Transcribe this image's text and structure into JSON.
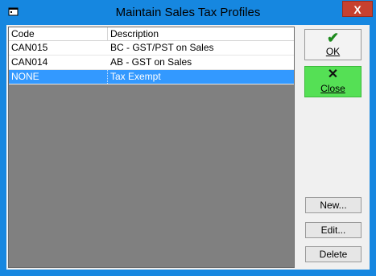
{
  "window": {
    "title": "Maintain Sales Tax Profiles",
    "close_glyph": "X"
  },
  "list": {
    "columns": {
      "code": "Code",
      "description": "Description"
    },
    "rows": [
      {
        "code": "CAN015",
        "description": "BC - GST/PST on Sales",
        "selected": false
      },
      {
        "code": "CAN014",
        "description": "AB - GST on Sales",
        "selected": false
      },
      {
        "code": "NONE",
        "description": "Tax Exempt",
        "selected": true
      }
    ]
  },
  "buttons": {
    "ok": {
      "label": "OK",
      "icon": "checkmark-icon",
      "glyph": "✔"
    },
    "close": {
      "label": "Close",
      "icon": "x-icon",
      "glyph": "✕"
    },
    "new": {
      "label": "New..."
    },
    "edit": {
      "label": "Edit..."
    },
    "delete": {
      "label": "Delete"
    }
  },
  "colors": {
    "titlebar": "#1687e0",
    "selection": "#3399ff",
    "close_button": "#55e055",
    "window_close": "#c7412f"
  }
}
